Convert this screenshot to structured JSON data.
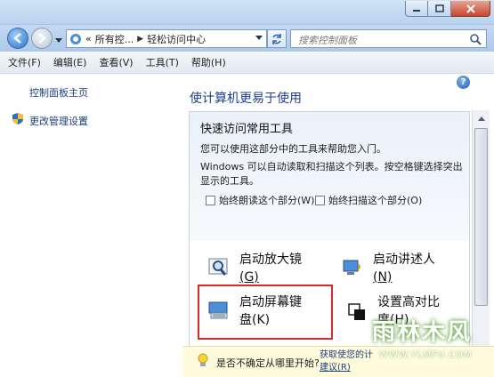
{
  "titlebar": {
    "min_icon": "minimize-icon",
    "max_icon": "maximize-icon",
    "close_icon": "close-icon"
  },
  "nav": {
    "breadcrumb_prefix": "«",
    "crumbs": [
      "所有控...",
      "轻松访问中心"
    ],
    "search_placeholder": "搜索控制面板"
  },
  "menu": [
    "文件(F)",
    "编辑(E)",
    "查看(V)",
    "工具(T)",
    "帮助(H)"
  ],
  "sidebar": {
    "home": "控制面板主页",
    "admin": "更改管理设置"
  },
  "main": {
    "heading": "使计算机更易于使用",
    "section_title": "快速访问常用工具",
    "desc1": "您可以使用这部分中的工具来帮助您入门。",
    "desc2": "Windows 可以自动读取和扫描这个列表。按空格键选择突出显示的工具。",
    "check_read": "始终朗读这个部分(W)",
    "check_scan": "始终扫描这个部分(O)",
    "tools": {
      "magnifier": [
        "启动放大镜",
        "(G)"
      ],
      "narrator": [
        "启动讲述人",
        "(N)"
      ],
      "keyboard": [
        "启动屏幕键",
        "盘(K)"
      ],
      "contrast": [
        "设置高对比",
        "度(H)"
      ]
    },
    "banner_question": "是否不确定从哪里开始?",
    "banner_link": [
      "获取使您的计",
      "建议(R)"
    ]
  },
  "watermark": {
    "main": "雨林木风",
    "sub": "WWW.YLMFU.COM"
  },
  "colors": {
    "accent": "#1e3f8f",
    "highlight": "#d62b2b",
    "banner": "#fffbdc"
  }
}
